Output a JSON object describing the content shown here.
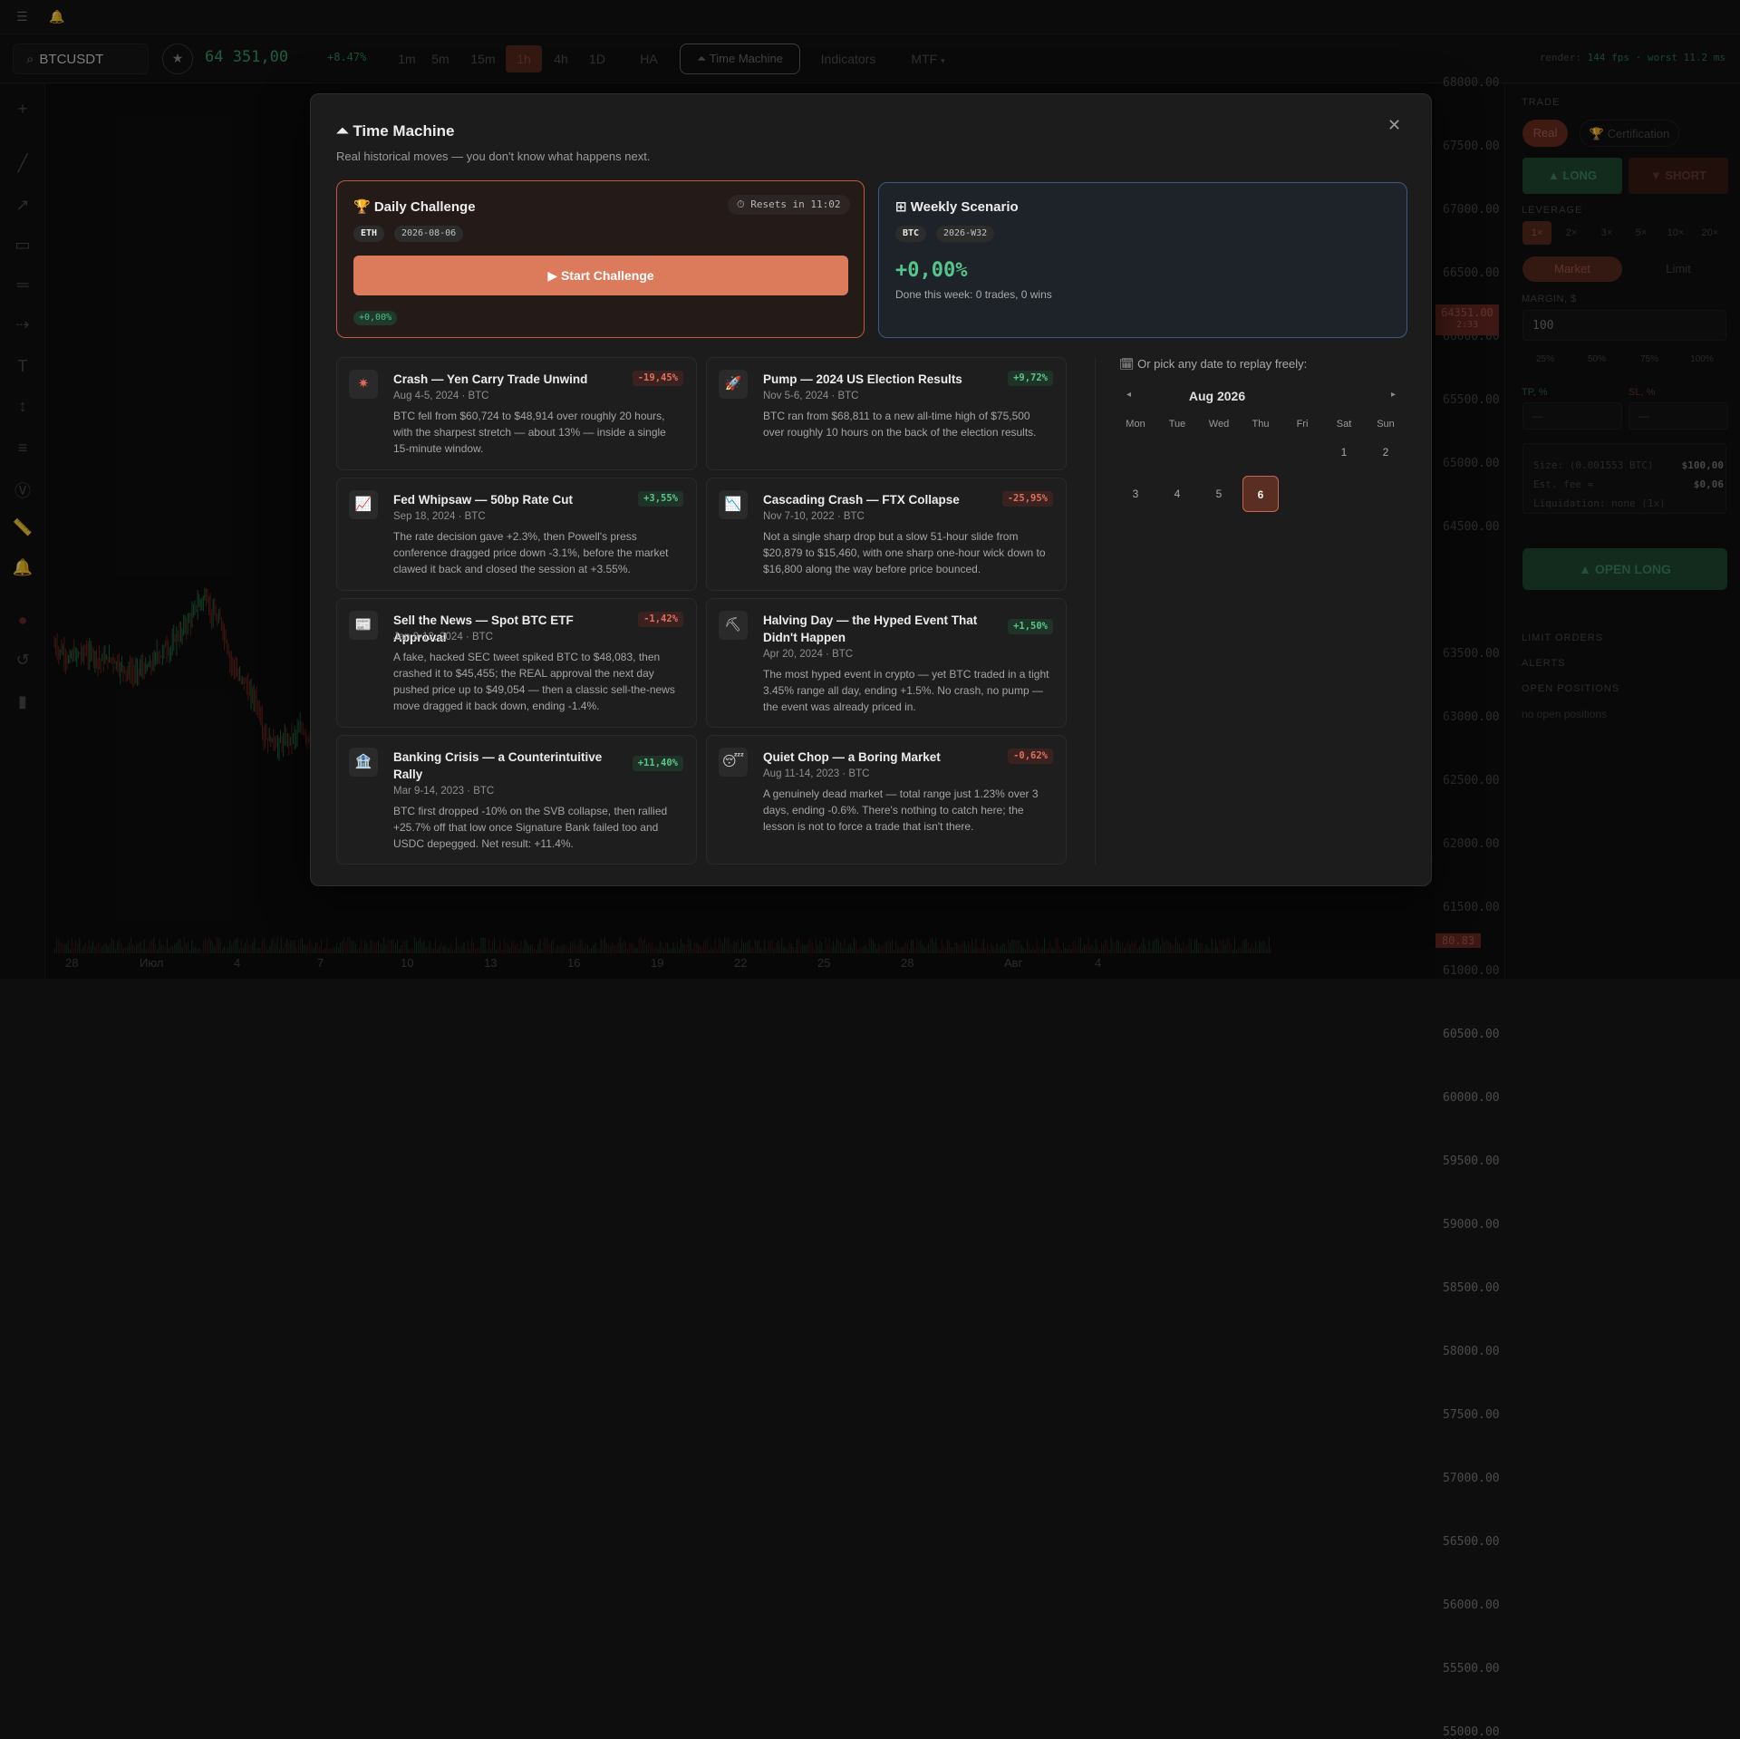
{
  "topstrip": {},
  "toolbar": {
    "symbol": "BTCUSDT",
    "price": "64 351,00",
    "change": "+8.47%",
    "timeframes": [
      "1m",
      "5m",
      "15m",
      "1h",
      "4h",
      "1D"
    ],
    "active_timeframe": "1h",
    "ha_label": "HA",
    "time_machine_label": "⏶ Time Machine",
    "indicators_label": "Indicators",
    "mtf_label": "MTF",
    "render_prefix": "render:",
    "render_fps": "144 fps · worst 11.2 ms"
  },
  "chart": {
    "y_labels": [
      "68000.00",
      "67500.00",
      "67000.00",
      "66500.00",
      "66000.00",
      "65500.00",
      "65000.00",
      "64500.00",
      "63500.00",
      "63000.00",
      "62500.00",
      "62000.00",
      "61500.00",
      "61000.00",
      "60500.00",
      "60000.00",
      "59500.00",
      "59000.00",
      "58500.00",
      "58000.00",
      "57500.00",
      "57000.00",
      "56500.00",
      "56000.00",
      "55500.00",
      "55000.00"
    ],
    "price_tag": "64351.00",
    "price_tag_timer": "2:33",
    "volume_tag": "80.83",
    "x_labels": [
      "28",
      "Июл",
      "4",
      "7",
      "10",
      "13",
      "16",
      "19",
      "22",
      "25",
      "28",
      "Авг",
      "4"
    ]
  },
  "trade_panel": {
    "trade_heading": "TRADE",
    "real_label": "Real",
    "cert_label": "🏆 Certification",
    "long_label": "▲ LONG",
    "short_label": "▼ SHORT",
    "leverage_heading": "LEVERAGE",
    "leverages": [
      "1×",
      "2×",
      "3×",
      "5×",
      "10×",
      "20×"
    ],
    "market_label": "Market",
    "limit_label": "Limit",
    "margin_heading": "MARGIN, $",
    "margin_value": "100",
    "percents": [
      "25%",
      "50%",
      "75%",
      "100%"
    ],
    "tp_label": "TP, %",
    "sl_label": "SL, %",
    "tp_value": "—",
    "sl_value": "—",
    "size_label": "Size: (0.001553 BTC)",
    "size_value": "$100,00",
    "fee_label": "Est. fee ≈",
    "fee_value": "$0,06",
    "liq_label": "Liquidation: none (1x)",
    "open_long_label": "▲ OPEN LONG",
    "limit_orders_heading": "LIMIT ORDERS",
    "alerts_heading": "ALERTS",
    "open_positions_heading": "OPEN POSITIONS",
    "no_positions": "no open positions"
  },
  "modal": {
    "title": "⏶ Time Machine",
    "subtitle": "Real historical moves — you don't know what happens next.",
    "daily": {
      "title": "🏆 Daily Challenge",
      "reset": "⏱ Resets in 11:02",
      "asset": "ETH",
      "date": "2026-08-06",
      "button": "▶ Start Challenge",
      "change": "+0,00%"
    },
    "weekly": {
      "title": "⊞ Weekly Scenario",
      "asset": "BTC",
      "week": "2026-W32",
      "change": "+0,00%",
      "summary": "Done this week: 0 trades, 0 wins"
    },
    "scenarios": [
      {
        "icon": "✷",
        "title": "Crash — Yen Carry Trade Unwind",
        "change": "-19,45%",
        "dir": "neg",
        "meta": "Aug 4-5, 2024 · BTC",
        "desc": "BTC fell from $60,724 to $48,914 over roughly 20 hours, with the sharpest stretch — about 13% — inside a single 15-minute window."
      },
      {
        "icon": "🚀",
        "title": "Pump — 2024 US Election Results",
        "change": "+9,72%",
        "dir": "pos",
        "meta": "Nov 5-6, 2024 · BTC",
        "desc": "BTC ran from $68,811 to a new all-time high of $75,500 over roughly 10 hours on the back of the election results."
      },
      {
        "icon": "📈",
        "title": "Fed Whipsaw — 50bp Rate Cut",
        "change": "+3,55%",
        "dir": "pos",
        "meta": "Sep 18, 2024 · BTC",
        "desc": "The rate decision gave +2.3%, then Powell's press conference dragged price down -3.1%, before the market clawed it back and closed the session at +3.55%."
      },
      {
        "icon": "📉",
        "title": "Cascading Crash — FTX Collapse",
        "change": "-25,95%",
        "dir": "neg",
        "meta": "Nov 7-10, 2022 · BTC",
        "desc": "Not a single sharp drop but a slow 51-hour slide from $20,879 to $15,460, with one sharp one-hour wick down to $16,800 along the way before price bounced."
      },
      {
        "icon": "📰",
        "title": "Sell the News — Spot BTC ETF Approval",
        "change": "-1,42%",
        "dir": "neg",
        "meta": "Jan 9-12, 2024 · BTC",
        "desc": "A fake, hacked SEC tweet spiked BTC to $48,083, then crashed it to $45,455; the REAL approval the next day pushed price up to $49,054 — then a classic sell-the-news move dragged it back down, ending -1.4%."
      },
      {
        "icon": "⛏",
        "title": "Halving Day — the Hyped Event That Didn't Happen",
        "change": "+1,50%",
        "dir": "pos",
        "meta": "Apr 20, 2024 · BTC",
        "desc": "The most hyped event in crypto — yet BTC traded in a tight 3.45% range all day, ending +1.5%. No crash, no pump — the event was already priced in."
      },
      {
        "icon": "🏦",
        "title": "Banking Crisis — a Counterintuitive Rally",
        "change": "+11,40%",
        "dir": "pos",
        "meta": "Mar 9-14, 2023 · BTC",
        "desc": "BTC first dropped -10% on the SVB collapse, then rallied +25.7% off that low once Signature Bank failed too and USDC depegged. Net result: +11.4%."
      },
      {
        "icon": "😴",
        "title": "Quiet Chop — a Boring Market",
        "change": "-0,62%",
        "dir": "neg",
        "meta": "Aug 11-14, 2023 · BTC",
        "desc": "A genuinely dead market — total range just 1.23% over 3 days, ending -0.6%. There's nothing to catch here; the lesson is not to force a trade that isn't there."
      }
    ],
    "calendar": {
      "heading": "🗓 Or pick any date to replay freely:",
      "month": "Aug 2026",
      "prev": "◂",
      "next": "▸",
      "dow": [
        "Mon",
        "Tue",
        "Wed",
        "Thu",
        "Fri",
        "Sat",
        "Sun"
      ],
      "week1": [
        "1",
        "2"
      ],
      "week2": [
        "3",
        "4",
        "5",
        "6"
      ],
      "selected": "6"
    },
    "close": "✕"
  }
}
